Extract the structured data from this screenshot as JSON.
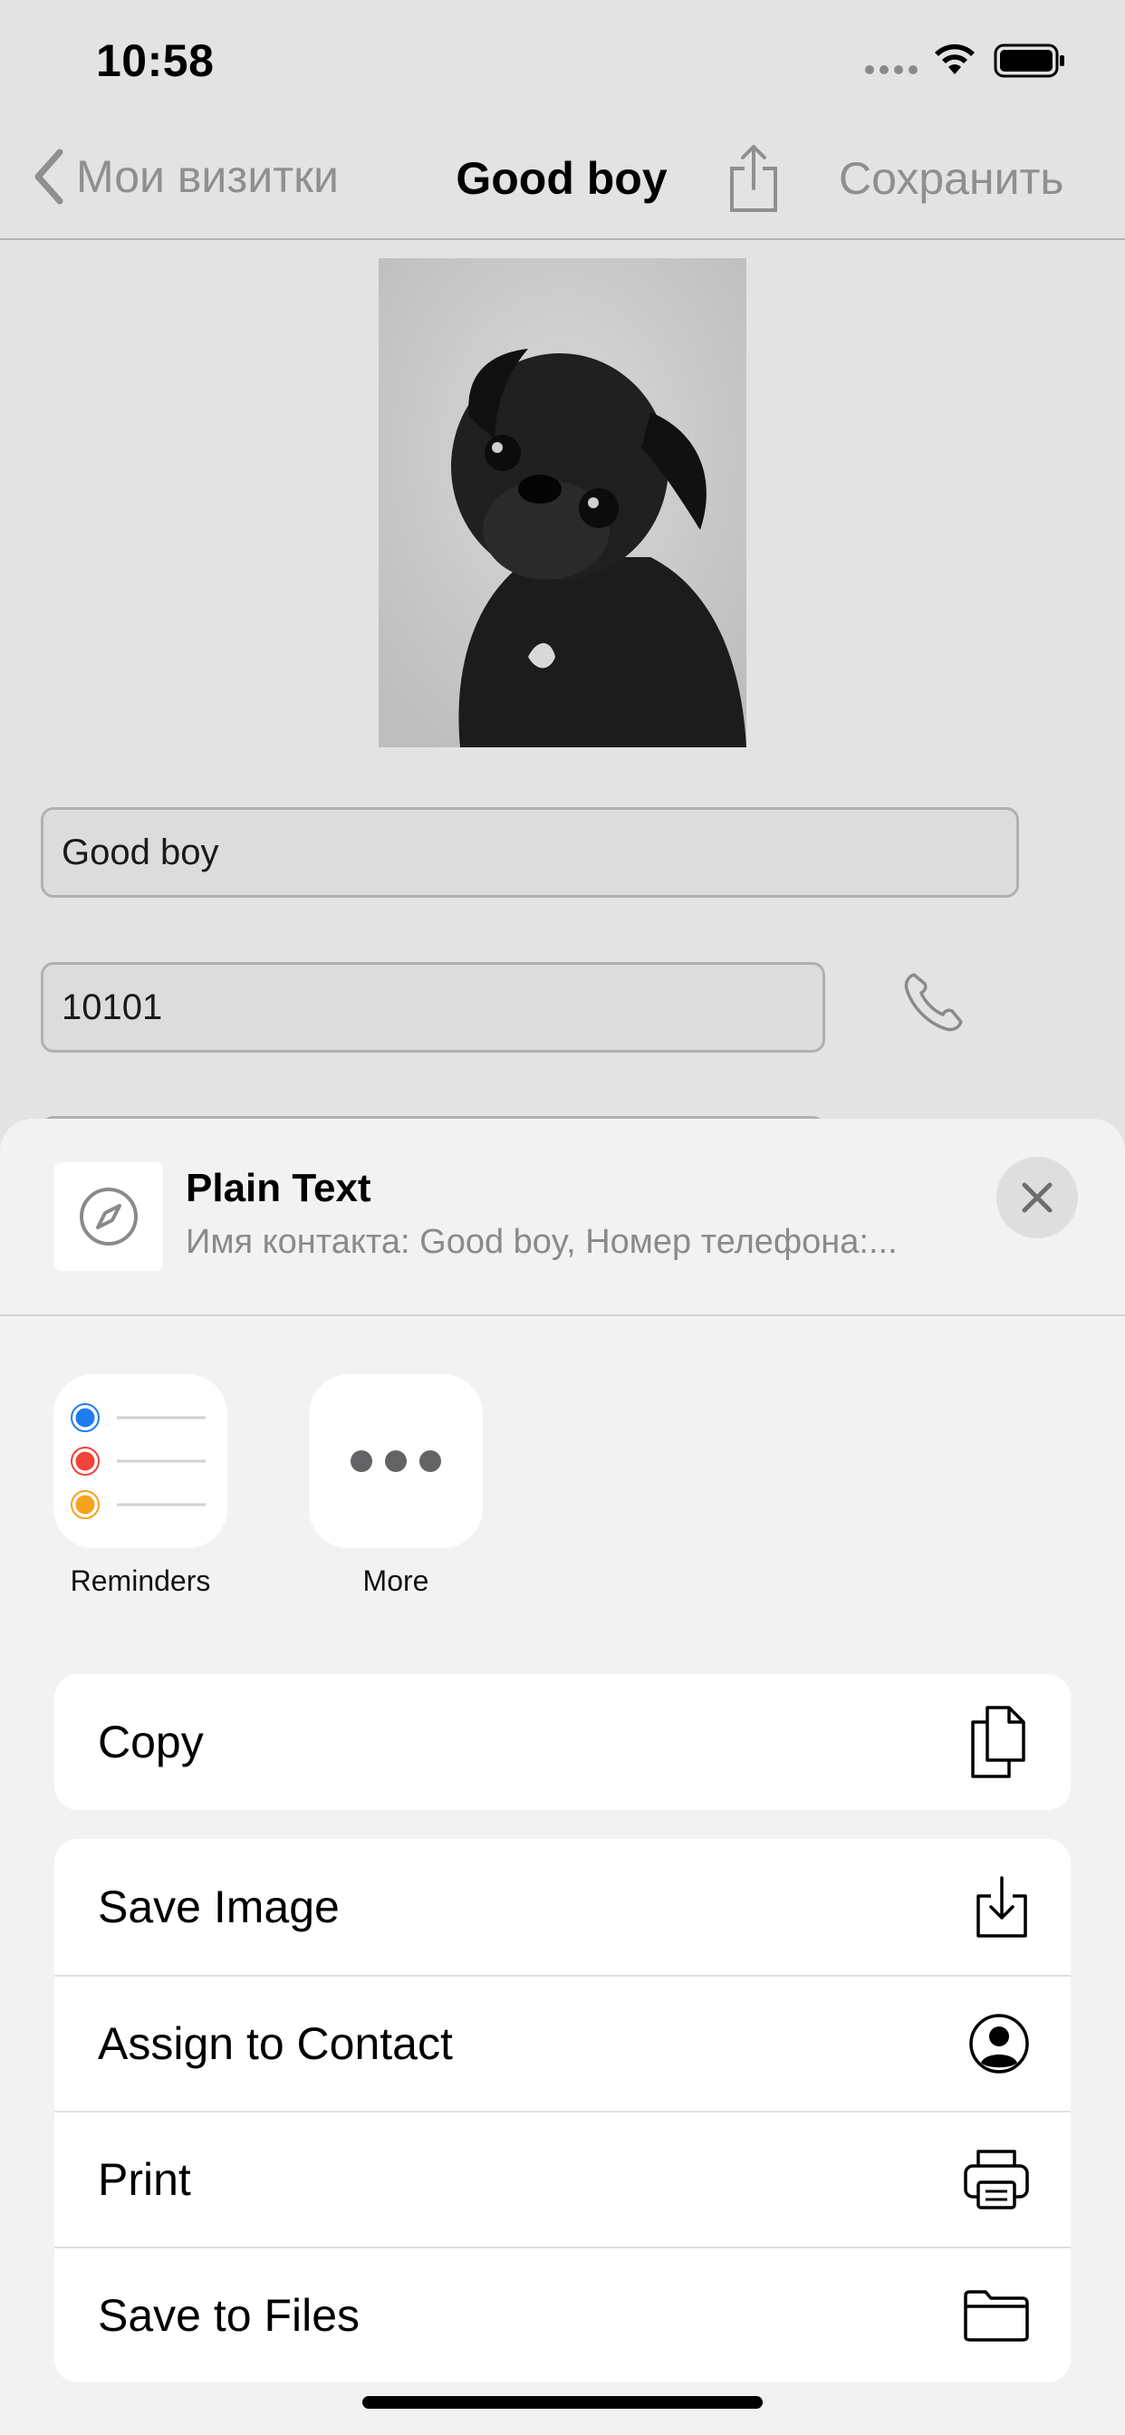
{
  "status_bar": {
    "time": "10:58"
  },
  "nav": {
    "back_label": "Мои визитки",
    "title": "Good boy",
    "save_label": "Сохранить"
  },
  "form": {
    "name_value": "Good boy",
    "phone_value": "10101"
  },
  "share_sheet": {
    "title": "Plain Text",
    "subtitle": "Имя контакта: Good boy, Номер телефона:...",
    "apps": [
      {
        "label": "Reminders",
        "icon": "reminders-icon"
      },
      {
        "label": "More",
        "icon": "more-icon"
      }
    ],
    "actions": [
      {
        "label": "Copy",
        "icon": "copy-icon"
      },
      {
        "label": "Save Image",
        "icon": "save-image-icon"
      },
      {
        "label": "Assign to Contact",
        "icon": "contact-icon"
      },
      {
        "label": "Print",
        "icon": "printer-icon"
      },
      {
        "label": "Save to Files",
        "icon": "folder-icon"
      }
    ]
  },
  "colors": {
    "dimmed_background": "#e3e3e3",
    "sheet_background": "#f2f2f2",
    "reminder_blue": "#1f7cf0",
    "reminder_red": "#f0433a",
    "reminder_orange": "#f6a21c"
  }
}
